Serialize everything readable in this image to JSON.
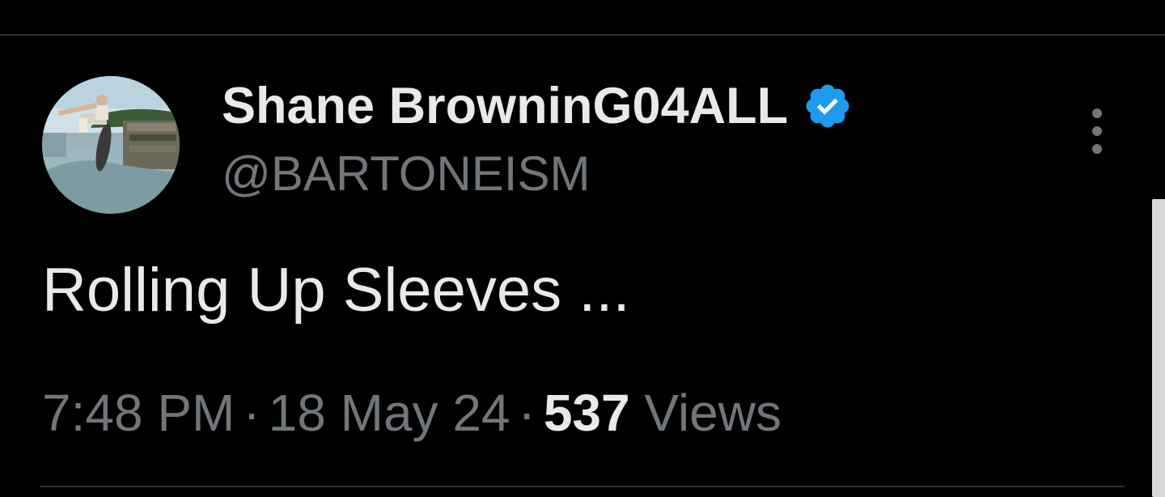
{
  "tweet": {
    "author": {
      "display_name": "Shane BrowninG04ALL",
      "handle": "@BARTONEISM",
      "verified": true,
      "avatar_icon": "skater-photo-avatar"
    },
    "text": "Rolling Up Sleeves ...",
    "meta": {
      "time": "7:48 PM",
      "separator": "·",
      "date": "18 May 24",
      "views_count": "537",
      "views_label": "Views"
    },
    "more_icon": "vertical-ellipsis-icon"
  },
  "colors": {
    "background": "#000000",
    "primary_text": "#e7e9ea",
    "secondary_text": "#71767b",
    "divider": "#2f3336",
    "verified_blue": "#1d9bf0"
  }
}
